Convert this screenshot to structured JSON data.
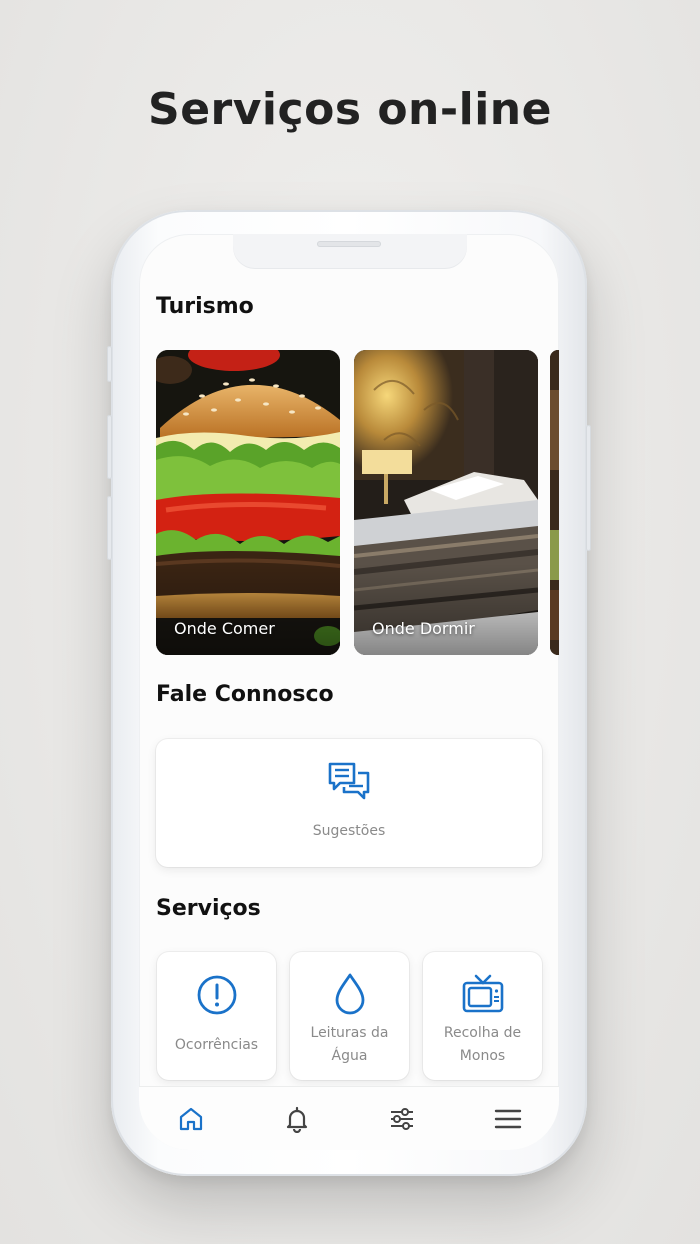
{
  "headline": "Serviços on-line",
  "turismo": {
    "title": "Turismo",
    "cards": [
      {
        "label": "Onde Comer",
        "icon": "burger-photo"
      },
      {
        "label": "Onde Dormir",
        "icon": "hotel-room-photo"
      }
    ]
  },
  "fale_connosco": {
    "title": "Fale Connosco",
    "card": {
      "label": "Sugestões",
      "icon": "chat-bubbles-icon"
    }
  },
  "servicos": {
    "title": "Serviços",
    "cards": [
      {
        "label": "Ocorrências",
        "icon": "alert-circle-icon"
      },
      {
        "label_line1": "Leituras da",
        "label_line2": "Água",
        "icon": "water-drop-icon"
      },
      {
        "label_line1": "Recolha de",
        "label_line2": "Monos",
        "icon": "tv-icon"
      }
    ]
  },
  "tabbar": {
    "items": [
      "home-icon",
      "bell-icon",
      "sliders-icon",
      "menu-icon"
    ],
    "active_color": "#1a72c9",
    "inactive_color": "#444444"
  },
  "accent_color": "#1a72c9"
}
